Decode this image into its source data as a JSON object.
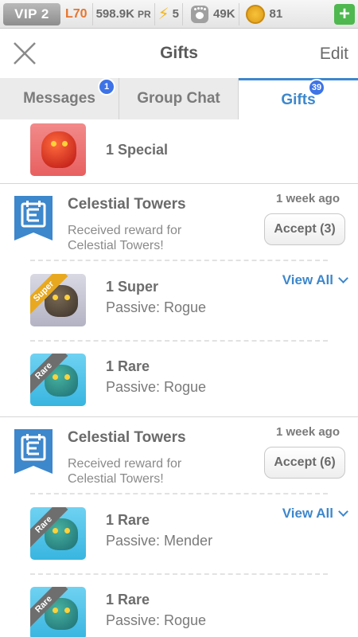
{
  "topbar": {
    "vip": "VIP 2",
    "level": "L70",
    "power": "598.9K",
    "power_suffix": "PR",
    "energy": "5",
    "pets": "49K",
    "coins": "81",
    "add_label": "+"
  },
  "nav": {
    "title": "Gifts",
    "edit_label": "Edit"
  },
  "tabs": [
    {
      "label": "Messages",
      "badge": "1"
    },
    {
      "label": "Group Chat",
      "badge": ""
    },
    {
      "label": "Gifts",
      "badge": "39",
      "active": true
    }
  ],
  "gifts": {
    "top_item": {
      "title": "1 Special",
      "rarity": "Special"
    },
    "groups": [
      {
        "sender": "Celestial Towers",
        "description": "Received reward for Celestial Towers!",
        "time": "1 week ago",
        "accept_label": "Accept (3)",
        "view_all_label": "View All",
        "items": [
          {
            "title": "1 Super",
            "sub": "Passive: Rogue",
            "ribbon": "Super"
          },
          {
            "title": "1 Rare",
            "sub": "Passive: Rogue",
            "ribbon": "Rare"
          }
        ]
      },
      {
        "sender": "Celestial Towers",
        "description": "Received reward for Celestial Towers!",
        "time": "1 week ago",
        "accept_label": "Accept (6)",
        "view_all_label": "View All",
        "items": [
          {
            "title": "1 Rare",
            "sub": "Passive: Mender",
            "ribbon": "Rare"
          },
          {
            "title": "1 Rare",
            "sub": "Passive: Rogue",
            "ribbon": "Rare"
          }
        ]
      }
    ]
  },
  "colors": {
    "accent": "#3d87cc",
    "badge": "#3d73e6",
    "level": "#e8742c",
    "add": "#4fb84f"
  }
}
